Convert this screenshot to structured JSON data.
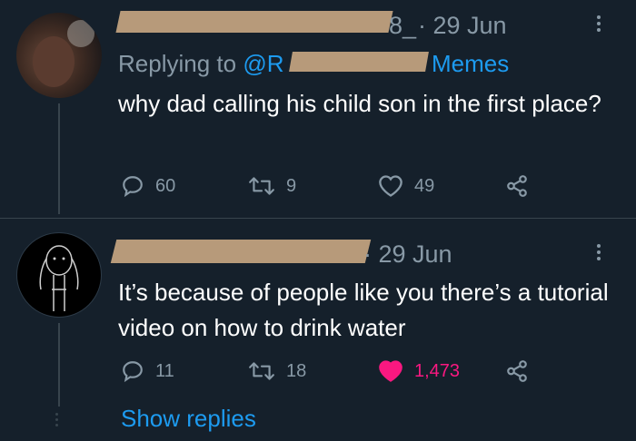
{
  "tweet1": {
    "handle_suffix": "8_",
    "date": "· 29 Jun",
    "replying_prefix": "Replying to ",
    "replying_handle_visible": "@R",
    "replying_handle_tail": "Memes",
    "text": "why dad calling his child son in the first place?",
    "replies": "60",
    "retweets": "9",
    "likes": "49"
  },
  "tweet2": {
    "date": "· 29 Jun",
    "text": "It’s because of people like you there’s a tutorial video on how to drink water",
    "replies": "11",
    "retweets": "18",
    "likes": "1,473",
    "liked": true
  },
  "show_replies": "Show replies",
  "colors": {
    "background": "#15202b",
    "muted": "#8899a6",
    "link": "#1d9bf0",
    "like_active": "#f91880"
  }
}
